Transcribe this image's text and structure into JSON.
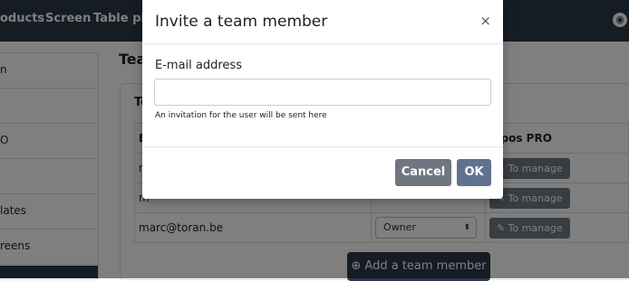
{
  "topbar": {
    "nav_items": [
      "oducts",
      "Screen",
      "Table pla"
    ]
  },
  "sidebar": {
    "items": [
      "n",
      "",
      "O",
      "",
      "lates",
      "reens"
    ]
  },
  "page": {
    "title": "Tea",
    "panel_heading": "Te"
  },
  "table": {
    "headers": [
      "E",
      "",
      "nipos PRO"
    ],
    "rows": [
      {
        "email": "m",
        "role": "",
        "action": "To manage"
      },
      {
        "email": "m",
        "role": "",
        "action": "To manage"
      },
      {
        "email": "marc@toran.be",
        "role": "Owner",
        "action": "To manage"
      }
    ]
  },
  "add_button": "Add a team member",
  "modal": {
    "title": "Invite a team member",
    "close": "×",
    "field_label": "E-mail address",
    "field_value": "",
    "help_text": "An invitation for the user will be sent here",
    "cancel_label": "Cancel",
    "ok_label": "OK"
  },
  "colors": {
    "topbar": "#2b3849",
    "cancel": "#6f7680",
    "ok": "#5f7390",
    "manage": "#707a85"
  }
}
